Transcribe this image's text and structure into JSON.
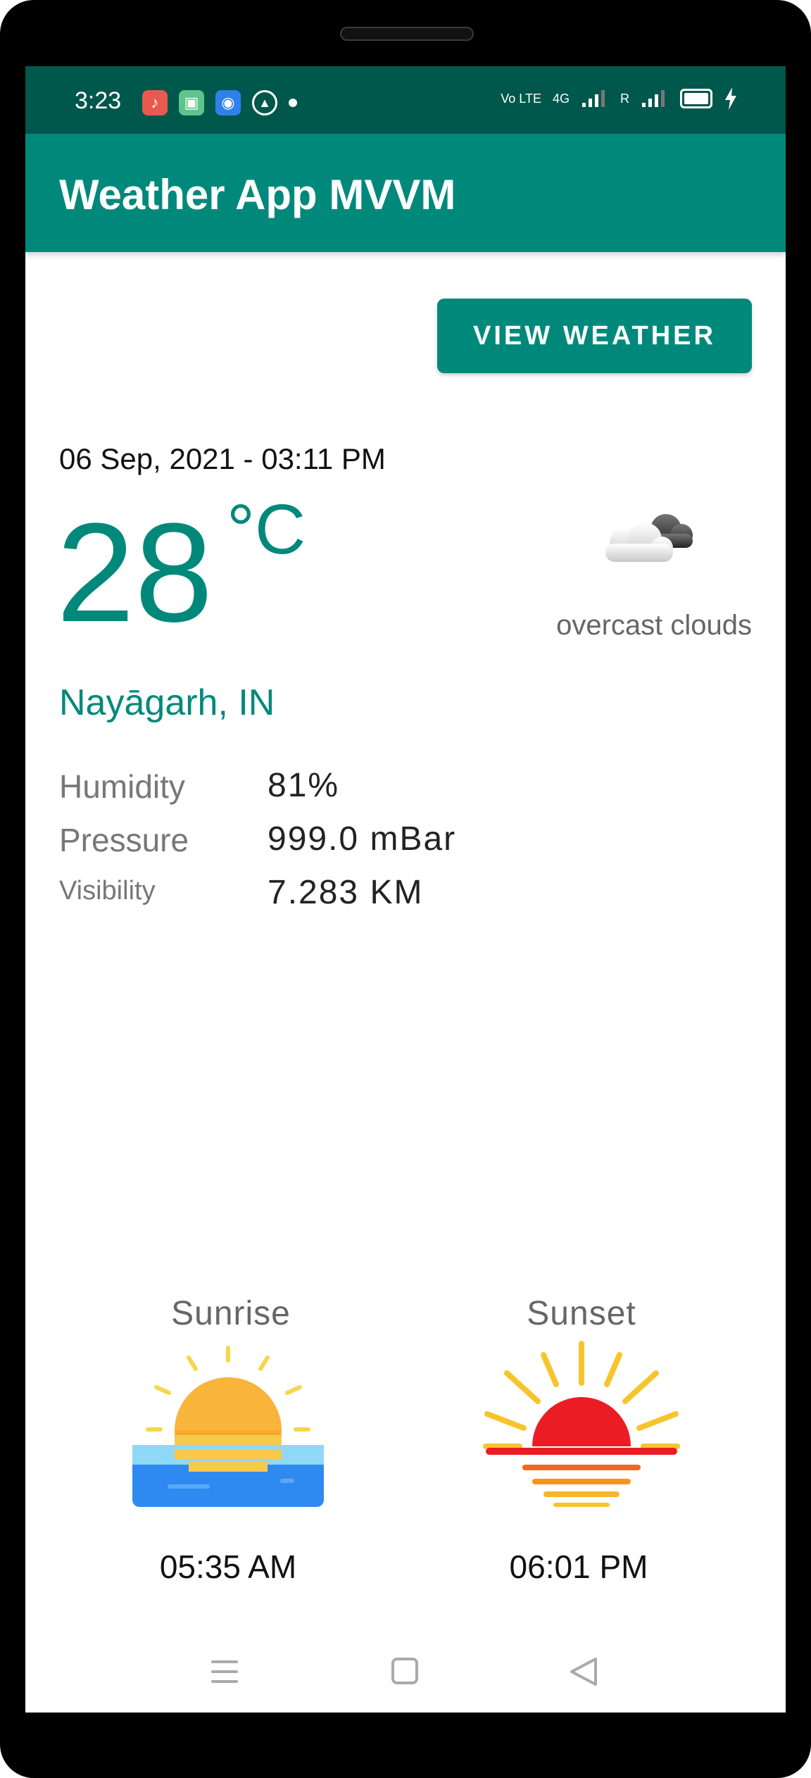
{
  "status_bar": {
    "time": "3:23",
    "network_left": "Vo LTE",
    "network_4g": "4G",
    "network_r": "R"
  },
  "app_bar": {
    "title": "Weather App MVVM"
  },
  "actions": {
    "view_weather_label": "VIEW WEATHER"
  },
  "weather": {
    "date_time": "06 Sep, 2021 - 03:11 PM",
    "temperature": "28",
    "unit": "°C",
    "description": "overcast clouds",
    "location": "Nayāgarh, IN",
    "icon": "overcast-cloud-icon"
  },
  "details": [
    {
      "label": "Humidity",
      "value": "81%"
    },
    {
      "label": "Pressure",
      "value": "999.0 mBar"
    },
    {
      "label": "Visibility",
      "value": "7.283 KM"
    }
  ],
  "sun": {
    "sunrise_label": "Sunrise",
    "sunrise_time": "05:35 AM",
    "sunset_label": "Sunset",
    "sunset_time": "06:01 PM"
  },
  "colors": {
    "primary": "#00897b",
    "status_bar": "#00574b",
    "sunrise_sun": "#f7a82b",
    "sunrise_water": "#2e8af0",
    "sunset_sun": "#ec1c24",
    "sunset_rays": "#f7c52b"
  },
  "nav_bar": [
    "menu-icon",
    "home-icon",
    "back-icon"
  ]
}
